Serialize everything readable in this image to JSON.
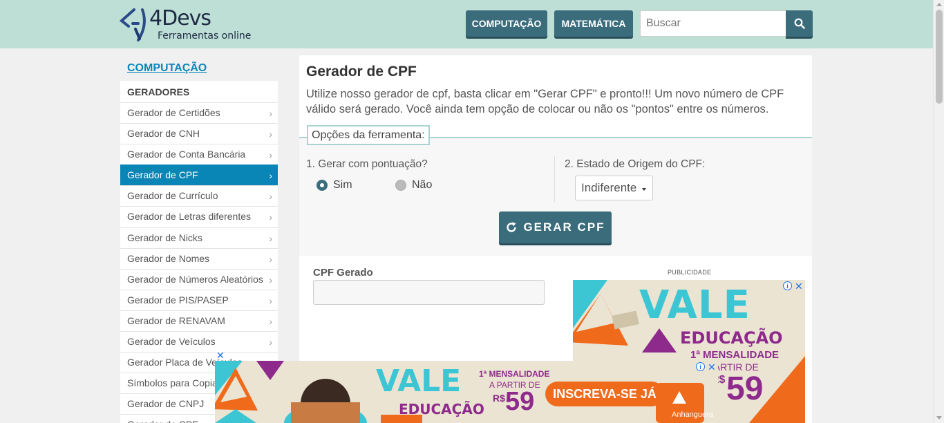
{
  "header": {
    "logo_name": "4Devs",
    "logo_sub": "Ferramentas online",
    "nav": [
      "COMPUTAÇÃO",
      "MATEMÁTICA"
    ],
    "search_placeholder": "Buscar"
  },
  "sidebar": {
    "title": "COMPUTAÇÃO",
    "group": "GERADORES",
    "items": [
      {
        "label": "Gerador de Certidões",
        "active": false
      },
      {
        "label": "Gerador de CNH",
        "active": false
      },
      {
        "label": "Gerador de Conta Bancária",
        "active": false
      },
      {
        "label": "Gerador de CPF",
        "active": true
      },
      {
        "label": "Gerador de Currículo",
        "active": false
      },
      {
        "label": "Gerador de Letras diferentes",
        "active": false
      },
      {
        "label": "Gerador de Nicks",
        "active": false
      },
      {
        "label": "Gerador de Nomes",
        "active": false
      },
      {
        "label": "Gerador de Números Aleatórios",
        "active": false
      },
      {
        "label": "Gerador de PIS/PASEP",
        "active": false
      },
      {
        "label": "Gerador de RENAVAM",
        "active": false
      },
      {
        "label": "Gerador de Veículos",
        "active": false
      },
      {
        "label": "Gerador Placa de Veículos",
        "active": false
      },
      {
        "label": "Símbolos para Copiar",
        "active": false
      },
      {
        "label": "Gerador de CNPJ",
        "active": false
      },
      {
        "label": "Gerador de CPF",
        "active": false
      }
    ]
  },
  "main": {
    "title": "Gerador de CPF",
    "description": "Utilize nosso gerador de cpf, basta clicar em \"Gerar CPF\" e pronto!!! Um novo número de CPF válido será gerado. Você ainda tem opção de colocar ou não os \"pontos\" entre os números.",
    "options_legend": "Opções da ferramenta:",
    "q1_label": "1. Gerar com pontuação?",
    "radio_yes": "Sim",
    "radio_no": "Não",
    "radio_selected": "Sim",
    "q2_label": "2. Estado de Origem do CPF:",
    "state_value": "Indiferente",
    "generate_button": "GERAR CPF",
    "result_label": "CPF Gerado",
    "result_value": "",
    "ad_label": "PUBLICIDADE"
  },
  "ads": {
    "right": {
      "brand": "VALE",
      "brand_sub": "EDUCAÇÃO",
      "offer_line1": "1ª MENSALIDADE",
      "offer_line2": "A PARTIR DE",
      "currency": "R$",
      "price": "59"
    },
    "bottom": {
      "brand": "VALE",
      "brand_sub": "EDUCAÇÃO",
      "offer_line1": "1ª MENSALIDADE",
      "offer_line2": "A PARTIR DE",
      "currency": "R$",
      "price": "59",
      "cta": "INSCREVA-SE JÁ",
      "partner": "Anhanguera"
    }
  },
  "colors": {
    "header_bg": "#bddfd6",
    "brand_button": "#3b6c7c",
    "active_item": "#0a86b6",
    "ad_purple": "#8e2a8c",
    "ad_teal": "#3cc6d4",
    "ad_orange": "#f06a1c"
  }
}
